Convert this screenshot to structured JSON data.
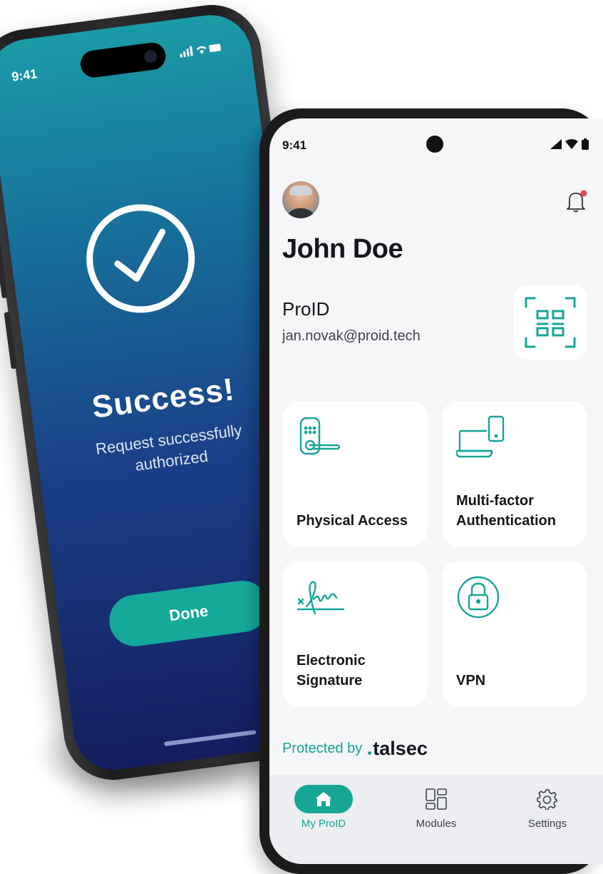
{
  "left_phone": {
    "status_time": "9:41",
    "title": "Success!",
    "subtitle": "Request successfully authorized",
    "done_label": "Done",
    "screen_gradient": [
      "#1a9aa6",
      "#141e5e"
    ],
    "button_color": "#15a99a"
  },
  "right_phone": {
    "status_time": "9:41",
    "user": {
      "name": "John Doe",
      "org": "ProID",
      "email": "jan.novak@proid.tech"
    },
    "notification_badge": true,
    "cards": [
      {
        "label": "Physical Access",
        "icon": "door-lock-icon"
      },
      {
        "label": "Multi-factor Authentication",
        "icon": "laptop-phone-icon"
      },
      {
        "label": "Electronic Signature",
        "icon": "signature-icon"
      },
      {
        "label": "VPN",
        "icon": "padlock-icon"
      }
    ],
    "protected_by": "Protected by",
    "brand": "talsec",
    "nav": [
      {
        "label": "My ProID",
        "icon": "home-icon",
        "active": true
      },
      {
        "label": "Modules",
        "icon": "modules-icon",
        "active": false
      },
      {
        "label": "Settings",
        "icon": "gear-icon",
        "active": false
      }
    ],
    "accent_color": "#17a596"
  }
}
